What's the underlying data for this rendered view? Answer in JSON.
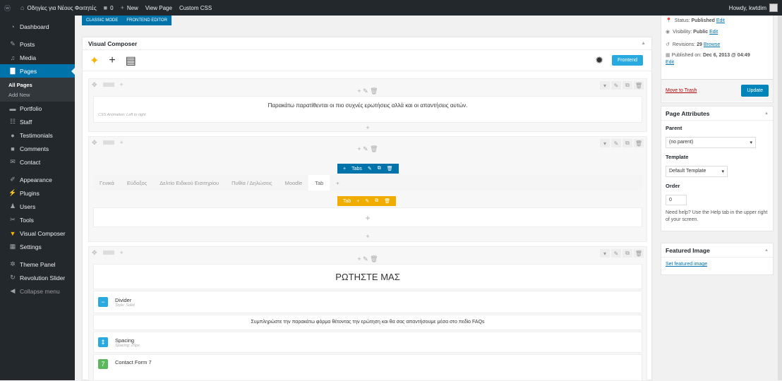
{
  "admin_bar": {
    "site_name": "Οδηγίες για Νέους Φοιτητές",
    "comments_count": "0",
    "new_label": "New",
    "view_page": "View Page",
    "custom_css": "Custom CSS",
    "howdy": "Howdy, kwtdim"
  },
  "sidebar": {
    "items": [
      {
        "label": "Dashboard",
        "icon": "dashboard-icon"
      },
      {
        "label": "Posts",
        "icon": "pin-icon"
      },
      {
        "label": "Media",
        "icon": "media-icon"
      },
      {
        "label": "Pages",
        "icon": "page-icon"
      },
      {
        "label": "Portfolio",
        "icon": "portfolio-icon"
      },
      {
        "label": "Staff",
        "icon": "staff-icon"
      },
      {
        "label": "Testimonials",
        "icon": "speech-icon"
      },
      {
        "label": "Comments",
        "icon": "comment-icon"
      },
      {
        "label": "Contact",
        "icon": "mail-icon"
      },
      {
        "label": "Appearance",
        "icon": "brush-icon"
      },
      {
        "label": "Plugins",
        "icon": "plug-icon"
      },
      {
        "label": "Users",
        "icon": "user-icon"
      },
      {
        "label": "Tools",
        "icon": "wrench-icon"
      },
      {
        "label": "Visual Composer",
        "icon": "vc-icon"
      },
      {
        "label": "Settings",
        "icon": "settings-icon"
      },
      {
        "label": "Theme Panel",
        "icon": "gear-icon"
      },
      {
        "label": "Revolution Slider",
        "icon": "refresh-icon"
      },
      {
        "label": "Collapse menu",
        "icon": "collapse-icon"
      }
    ],
    "submenu": [
      "All Pages",
      "Add New"
    ]
  },
  "editor": {
    "mode_classic": "CLASSIC MODE",
    "mode_frontend": "FRONTEND EDITOR",
    "vc_title": "Visual Composer",
    "frontend_btn": "Frontend",
    "row1_text": "Παρακάτω παρατίθενται οι πιο συχνές ερωτήσεις αλλά και οι απαντήσεις αυτών.",
    "row1_animation": "CSS Animation: Left to right",
    "tabs_label": "Tabs",
    "tab_label": "Tab",
    "tabs": [
      "Γενικά",
      "Εύδοξος",
      "Δελτίο Ειδικού Εισιτηρίου",
      "Πυθία / Δηλώσεις",
      "Moodle",
      "Tab"
    ],
    "row3_heading": "ΡΩΤΗΣΤΕ ΜΑΣ",
    "divider_title": "Divider",
    "divider_sub": "Style: Solid",
    "row3_text": "Συμπληρώστε την παρακάτω φόρμα θέτοντας την ερώτηση και θα σας απαντήσουμε μέσα στο πεδίο FAQs",
    "spacing_title": "Spacing",
    "spacing_sub": "Spacing: 25px",
    "contact_title": "Contact Form 7"
  },
  "publish": {
    "status_label": "Status:",
    "status_value": "Published",
    "edit": "Edit",
    "visibility_label": "Visibility:",
    "visibility_value": "Public",
    "revisions_label": "Revisions:",
    "revisions_value": "29",
    "browse": "Browse",
    "published_on_label": "Published on:",
    "published_on_value": "Dec 6, 2013 @ 04:49",
    "trash": "Move to Trash",
    "update": "Update"
  },
  "attributes": {
    "title": "Page Attributes",
    "parent_label": "Parent",
    "parent_value": "(no parent)",
    "template_label": "Template",
    "template_value": "Default Template",
    "order_label": "Order",
    "order_value": "0",
    "help": "Need help? Use the Help tab in the upper right of your screen."
  },
  "featured": {
    "title": "Featured Image",
    "link": "Set featured image"
  },
  "colors": {
    "sidebar_bg": "#23282d",
    "active": "#0073aa",
    "frontend": "#28aae1",
    "tab_orange": "#f0ad00",
    "divider_icon": "#28aae1",
    "contact_icon": "#5cb85c"
  }
}
